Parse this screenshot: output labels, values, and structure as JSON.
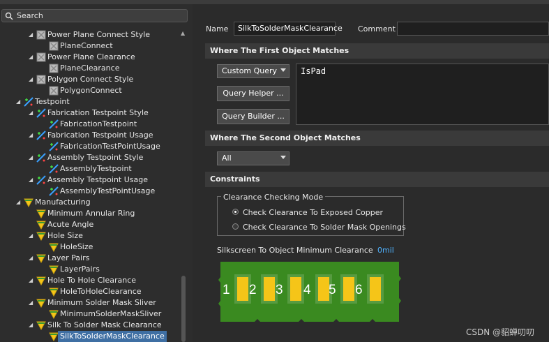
{
  "search": {
    "placeholder": "Search"
  },
  "tree": [
    {
      "label": "Power Plane Connect Style",
      "icon": "rule-category-icon",
      "expanded": true
    },
    {
      "label": "PlaneConnect",
      "icon": "rule-icon"
    },
    {
      "label": "Power Plane Clearance",
      "icon": "rule-category-icon",
      "expanded": true
    },
    {
      "label": "PlaneClearance",
      "icon": "rule-icon"
    },
    {
      "label": "Polygon Connect Style",
      "icon": "rule-category-icon",
      "expanded": true
    },
    {
      "label": "PolygonConnect",
      "icon": "rule-icon"
    },
    {
      "label": "Testpoint",
      "icon": "testpoint-icon",
      "expanded": true
    },
    {
      "label": "Fabrication Testpoint Style",
      "icon": "testpoint-icon",
      "expanded": true
    },
    {
      "label": "FabricationTestpoint",
      "icon": "testpoint-rule-icon"
    },
    {
      "label": "Fabrication Testpoint Usage",
      "icon": "testpoint-icon",
      "expanded": true
    },
    {
      "label": "FabricationTestPointUsage",
      "icon": "testpoint-rule-icon"
    },
    {
      "label": "Assembly Testpoint Style",
      "icon": "testpoint-icon",
      "expanded": true
    },
    {
      "label": "AssemblyTestpoint",
      "icon": "testpoint-rule-icon"
    },
    {
      "label": "Assembly Testpoint Usage",
      "icon": "testpoint-icon",
      "expanded": true
    },
    {
      "label": "AssemblyTestPointUsage",
      "icon": "testpoint-rule-icon"
    },
    {
      "label": "Manufacturing",
      "icon": "manufacturing-icon",
      "expanded": true
    },
    {
      "label": "Minimum Annular Ring",
      "icon": "manufacturing-icon"
    },
    {
      "label": "Acute Angle",
      "icon": "manufacturing-icon"
    },
    {
      "label": "Hole Size",
      "icon": "manufacturing-icon",
      "expanded": true
    },
    {
      "label": "HoleSize",
      "icon": "manufacturing-rule-icon"
    },
    {
      "label": "Layer Pairs",
      "icon": "manufacturing-icon",
      "expanded": true
    },
    {
      "label": "LayerPairs",
      "icon": "manufacturing-rule-icon"
    },
    {
      "label": "Hole To Hole Clearance",
      "icon": "manufacturing-icon",
      "expanded": true
    },
    {
      "label": "HoleToHoleClearance",
      "icon": "manufacturing-rule-icon"
    },
    {
      "label": "Minimum Solder Mask Sliver",
      "icon": "manufacturing-icon",
      "expanded": true
    },
    {
      "label": "MinimumSolderMaskSliver",
      "icon": "manufacturing-rule-icon"
    },
    {
      "label": "Silk To Solder Mask Clearance",
      "icon": "manufacturing-icon",
      "expanded": true
    },
    {
      "label": "SilkToSolderMaskClearance",
      "icon": "manufacturing-rule-icon",
      "selected": true
    }
  ],
  "rule": {
    "name_label": "Name",
    "name_value": "SilkToSolderMaskClearance",
    "comment_label": "Comment",
    "comment_value": ""
  },
  "first_object": {
    "header": "Where The First Object Matches",
    "scope_selected": "Custom Query",
    "query_helper_label": "Query Helper ...",
    "query_builder_label": "Query Builder ...",
    "query": "IsPad"
  },
  "second_object": {
    "header": "Where The Second Object Matches",
    "scope_selected": "All"
  },
  "constraints": {
    "header": "Constraints",
    "mode_title": "Clearance Checking Mode",
    "option_exposed": "Check Clearance To Exposed Copper",
    "option_openings": "Check Clearance To Solder Mask Openings",
    "selected_option": "exposed",
    "param_label": "Silkscreen To Object Minimum Clearance",
    "param_value": "0mil",
    "pad_labels": [
      "1",
      "2",
      "3",
      "4",
      "5",
      "6"
    ]
  },
  "colors": {
    "board_green": "#3a8a20",
    "pad_yellow": "#f5c518",
    "selection": "#3f6fa3",
    "value_blue": "#4fb2ff"
  },
  "watermark": "CSDN @貂蝉叨叨"
}
